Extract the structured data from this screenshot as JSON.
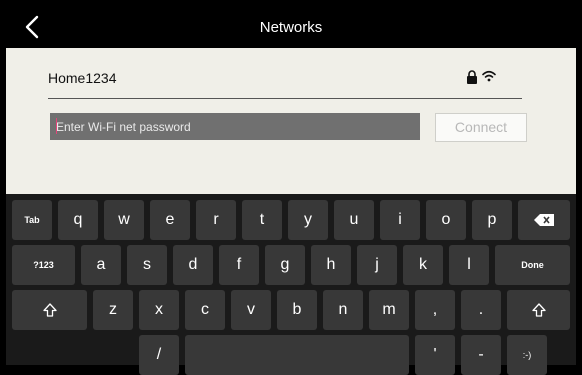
{
  "header": {
    "title": "Networks",
    "back_icon": "chevron-left-icon"
  },
  "network": {
    "name": "Home1234",
    "secured_icon": "lock-icon",
    "signal_icon": "wifi-icon"
  },
  "password": {
    "placeholder": "Enter Wi-Fi net password",
    "value": ""
  },
  "connect_label": "Connect",
  "keyboard": {
    "tab_label": "Tab",
    "numbers_label": "?123",
    "done_label": "Done",
    "emoticon_label": ":-)",
    "row1": [
      "q",
      "w",
      "e",
      "r",
      "t",
      "y",
      "u",
      "i",
      "o",
      "p"
    ],
    "row2": [
      "a",
      "s",
      "d",
      "f",
      "g",
      "h",
      "j",
      "k",
      "l"
    ],
    "row3": [
      "z",
      "x",
      "c",
      "v",
      "b",
      "n",
      "m",
      ",",
      "."
    ],
    "row4": [
      "/",
      "'",
      "-"
    ]
  },
  "colors": {
    "panel_bg": "#f0efe8",
    "input_bg": "#707070",
    "caret": "#e0457a",
    "key_bg": "#383838",
    "keyboard_bg": "#1a1a1a"
  }
}
